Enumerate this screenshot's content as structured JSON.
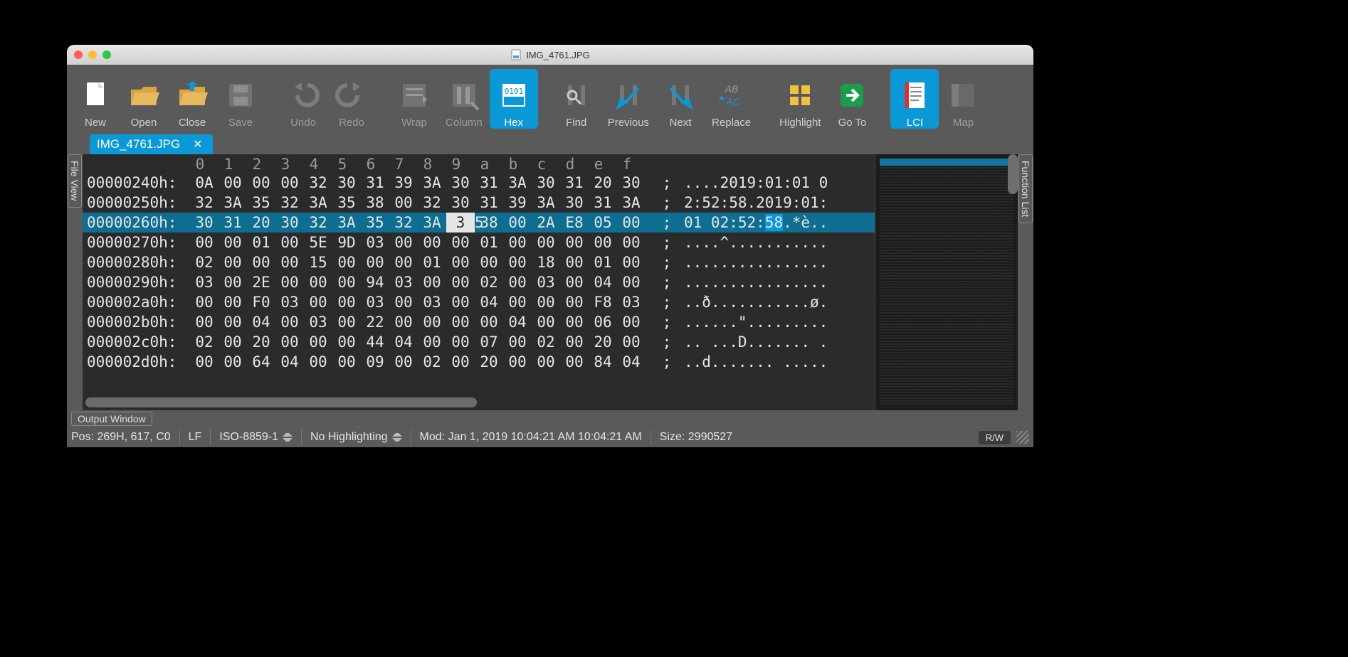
{
  "window_title": "IMG_4761.JPG",
  "toolbar": [
    {
      "id": "new",
      "label": "New",
      "dim": false,
      "sel": false
    },
    {
      "id": "open",
      "label": "Open",
      "dim": false,
      "sel": false
    },
    {
      "id": "close",
      "label": "Close",
      "dim": false,
      "sel": false
    },
    {
      "id": "save",
      "label": "Save",
      "dim": true,
      "sel": false
    },
    {
      "id": "gap"
    },
    {
      "id": "undo",
      "label": "Undo",
      "dim": true,
      "sel": false
    },
    {
      "id": "redo",
      "label": "Redo",
      "dim": true,
      "sel": false
    },
    {
      "id": "gap"
    },
    {
      "id": "wrap",
      "label": "Wrap",
      "dim": true,
      "sel": false
    },
    {
      "id": "column",
      "label": "Column",
      "dim": true,
      "sel": false
    },
    {
      "id": "hex",
      "label": "Hex",
      "dim": false,
      "sel": true
    },
    {
      "id": "gap"
    },
    {
      "id": "find",
      "label": "Find",
      "dim": false,
      "sel": false
    },
    {
      "id": "previous",
      "label": "Previous",
      "dim": false,
      "sel": false
    },
    {
      "id": "next",
      "label": "Next",
      "dim": false,
      "sel": false
    },
    {
      "id": "replace",
      "label": "Replace",
      "dim": false,
      "sel": false
    },
    {
      "id": "gap"
    },
    {
      "id": "highlight",
      "label": "Highlight",
      "dim": false,
      "sel": false
    },
    {
      "id": "goto",
      "label": "Go To",
      "dim": false,
      "sel": false
    },
    {
      "id": "gap"
    },
    {
      "id": "lci",
      "label": "LCI",
      "dim": false,
      "sel": true
    },
    {
      "id": "map",
      "label": "Map",
      "dim": true,
      "sel": false
    }
  ],
  "tab": {
    "label": "IMG_4761.JPG"
  },
  "side_left": "File View",
  "side_right": "Function List",
  "ruler": [
    "0",
    "1",
    "2",
    "3",
    "4",
    "5",
    "6",
    "7",
    "8",
    "9",
    "a",
    "b",
    "c",
    "d",
    "e",
    "f"
  ],
  "rows": [
    {
      "addr": "00000240h:",
      "bytes": [
        "0A",
        "00",
        "00",
        "00",
        "32",
        "30",
        "31",
        "39",
        "3A",
        "30",
        "31",
        "3A",
        "30",
        "31",
        "20",
        "30"
      ],
      "ascii": "....2019:01:01 0",
      "sel": false
    },
    {
      "addr": "00000250h:",
      "bytes": [
        "32",
        "3A",
        "35",
        "32",
        "3A",
        "35",
        "38",
        "00",
        "32",
        "30",
        "31",
        "39",
        "3A",
        "30",
        "31",
        "3A"
      ],
      "ascii": "2:52:58.2019:01:",
      "sel": false
    },
    {
      "addr": "00000260h:",
      "bytes": [
        "30",
        "31",
        "20",
        "30",
        "32",
        "3A",
        "35",
        "32",
        "3A",
        "35",
        "38",
        "00",
        "2A",
        "E8",
        "05",
        "00"
      ],
      "ascii": "01 02:52:58.*è..",
      "sel": true,
      "cursor": 9,
      "asc_hl": [
        9,
        11
      ]
    },
    {
      "addr": "00000270h:",
      "bytes": [
        "00",
        "00",
        "01",
        "00",
        "5E",
        "9D",
        "03",
        "00",
        "00",
        "00",
        "01",
        "00",
        "00",
        "00",
        "00",
        "00"
      ],
      "ascii": "....^...........",
      "sel": false
    },
    {
      "addr": "00000280h:",
      "bytes": [
        "02",
        "00",
        "00",
        "00",
        "15",
        "00",
        "00",
        "00",
        "01",
        "00",
        "00",
        "00",
        "18",
        "00",
        "01",
        "00"
      ],
      "ascii": "................",
      "sel": false
    },
    {
      "addr": "00000290h:",
      "bytes": [
        "03",
        "00",
        "2E",
        "00",
        "00",
        "00",
        "94",
        "03",
        "00",
        "00",
        "02",
        "00",
        "03",
        "00",
        "04",
        "00"
      ],
      "ascii": "................",
      "sel": false
    },
    {
      "addr": "000002a0h:",
      "bytes": [
        "00",
        "00",
        "F0",
        "03",
        "00",
        "00",
        "03",
        "00",
        "03",
        "00",
        "04",
        "00",
        "00",
        "00",
        "F8",
        "03"
      ],
      "ascii": "..ð...........ø.",
      "sel": false
    },
    {
      "addr": "000002b0h:",
      "bytes": [
        "00",
        "00",
        "04",
        "00",
        "03",
        "00",
        "22",
        "00",
        "00",
        "00",
        "00",
        "04",
        "00",
        "00",
        "06",
        "00"
      ],
      "ascii": "......\".........",
      "sel": false
    },
    {
      "addr": "000002c0h:",
      "bytes": [
        "02",
        "00",
        "20",
        "00",
        "00",
        "00",
        "44",
        "04",
        "00",
        "00",
        "07",
        "00",
        "02",
        "00",
        "20",
        "00"
      ],
      "ascii": ".. ...D....... .",
      "sel": false
    },
    {
      "addr": "000002d0h:",
      "bytes": [
        "00",
        "00",
        "64",
        "04",
        "00",
        "00",
        "09",
        "00",
        "02",
        "00",
        "20",
        "00",
        "00",
        "00",
        "84",
        "04"
      ],
      "ascii": "..d....... .....",
      "sel": false
    }
  ],
  "output_window": "Output Window",
  "status": {
    "pos": "Pos: 269H, 617, C0",
    "le": "LF",
    "enc": "ISO-8859-1",
    "hl": "No Highlighting",
    "mod": "Mod: Jan 1, 2019 10:04:21 AM 10:04:21 AM",
    "size": "Size: 2990527",
    "rw": "R/W"
  }
}
